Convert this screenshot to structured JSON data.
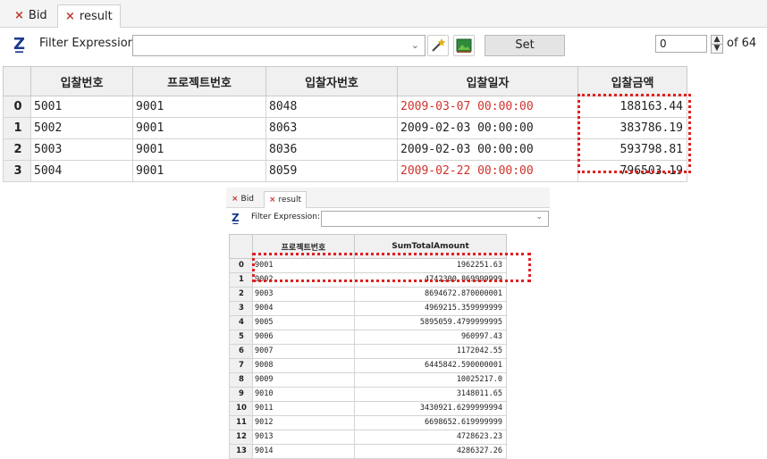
{
  "top": {
    "tabs": [
      {
        "label": "Bid",
        "close": "×"
      },
      {
        "label": "result",
        "close": "×"
      }
    ],
    "filter_label": "Filter Expression:",
    "filter_value": "",
    "set_label": "Set",
    "page_value": "0",
    "page_total": "of 64",
    "columns": [
      "입찰번호",
      "프로젝트번호",
      "입찰자번호",
      "입찰일자",
      "입찰금액"
    ],
    "rows": [
      {
        "idx": "0",
        "c1": "5001",
        "c2": "9001",
        "c3": "8048",
        "c4": "2009-03-07 00:00:00",
        "c5": "188163.44",
        "date_red": true
      },
      {
        "idx": "1",
        "c1": "5002",
        "c2": "9001",
        "c3": "8063",
        "c4": "2009-02-03 00:00:00",
        "c5": "383786.19",
        "date_red": false
      },
      {
        "idx": "2",
        "c1": "5003",
        "c2": "9001",
        "c3": "8036",
        "c4": "2009-02-03 00:00:00",
        "c5": "593798.81",
        "date_red": false
      },
      {
        "idx": "3",
        "c1": "5004",
        "c2": "9001",
        "c3": "8059",
        "c4": "2009-02-22 00:00:00",
        "c5": "796503.19",
        "date_red": true
      }
    ]
  },
  "bottom": {
    "tabs": [
      {
        "label": "Bid",
        "close": "×"
      },
      {
        "label": "result",
        "close": "×"
      }
    ],
    "filter_label": "Filter Expression:",
    "filter_value": "",
    "columns": [
      "프로젝트번호",
      "SumTotalAmount"
    ],
    "rows": [
      {
        "idx": "0",
        "project": "9001",
        "sum": "1962251.63"
      },
      {
        "idx": "1",
        "project": "9002",
        "sum": "4742300.869999999"
      },
      {
        "idx": "2",
        "project": "9003",
        "sum": "8694672.870000001"
      },
      {
        "idx": "3",
        "project": "9004",
        "sum": "4969215.359999999"
      },
      {
        "idx": "4",
        "project": "9005",
        "sum": "5895059.4799999995"
      },
      {
        "idx": "5",
        "project": "9006",
        "sum": "960997.43"
      },
      {
        "idx": "6",
        "project": "9007",
        "sum": "1172042.55"
      },
      {
        "idx": "7",
        "project": "9008",
        "sum": "6445842.590000001"
      },
      {
        "idx": "8",
        "project": "9009",
        "sum": "10025217.0"
      },
      {
        "idx": "9",
        "project": "9010",
        "sum": "3148011.65"
      },
      {
        "idx": "10",
        "project": "9011",
        "sum": "3430921.6299999994"
      },
      {
        "idx": "11",
        "project": "9012",
        "sum": "6698652.619999999"
      },
      {
        "idx": "12",
        "project": "9013",
        "sum": "4728623.23"
      },
      {
        "idx": "13",
        "project": "9014",
        "sum": "4286327.26"
      }
    ]
  },
  "colors": {
    "highlight": "#e02020",
    "red_text": "#d0322b",
    "header_bg": "#f0f0f0"
  },
  "icons": [
    "close-icon",
    "filter-funnel-icon",
    "magic-wand-icon",
    "picture-icon",
    "chevron-down-icon",
    "spinner-up-icon",
    "spinner-down-icon"
  ]
}
